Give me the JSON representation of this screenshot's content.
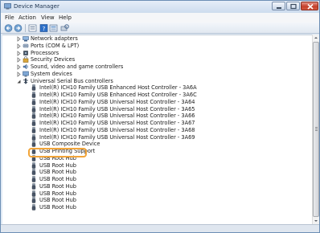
{
  "window": {
    "title": "Device Manager"
  },
  "menu": [
    "File",
    "Action",
    "View",
    "Help"
  ],
  "toolbar": [
    "back-icon",
    "forward-icon",
    "properties-icon",
    "help-icon",
    "show-hidden-icon",
    "scan-hardware-icon"
  ],
  "tree": {
    "collapsed_categories": [
      {
        "label": "Network adapters",
        "icon": "network-adapter-icon"
      },
      {
        "label": "Ports (COM & LPT)",
        "icon": "port-icon"
      },
      {
        "label": "Processors",
        "icon": "processor-icon"
      },
      {
        "label": "Security Devices",
        "icon": "security-device-icon"
      },
      {
        "label": "Sound, video and game controllers",
        "icon": "sound-icon"
      },
      {
        "label": "System devices",
        "icon": "system-device-icon"
      }
    ],
    "expanded_category": {
      "label": "Universal Serial Bus controllers",
      "icon": "usb-controller-icon"
    },
    "usb_devices": [
      "Intel(R) ICH10 Family USB Enhanced Host Controller - 3A6A",
      "Intel(R) ICH10 Family USB Enhanced Host Controller - 3A6C",
      "Intel(R) ICH10 Family USB Universal Host Controller - 3A64",
      "Intel(R) ICH10 Family USB Universal Host Controller - 3A65",
      "Intel(R) ICH10 Family USB Universal Host Controller - 3A66",
      "Intel(R) ICH10 Family USB Universal Host Controller - 3A67",
      "Intel(R) ICH10 Family USB Universal Host Controller - 3A68",
      "Intel(R) ICH10 Family USB Universal Host Controller - 3A69",
      "USB Composite Device",
      "USB Printing Support",
      "USB Root Hub",
      "USB Root Hub",
      "USB Root Hub",
      "USB Root Hub",
      "USB Root Hub",
      "USB Root Hub",
      "USB Root Hub",
      "USB Root Hub"
    ],
    "highlighted_device": "USB Printing Support"
  },
  "colors": {
    "highlight_border": "#f2a53a",
    "window_frame": "#6d8fb5",
    "close_button": "#c4402b"
  }
}
